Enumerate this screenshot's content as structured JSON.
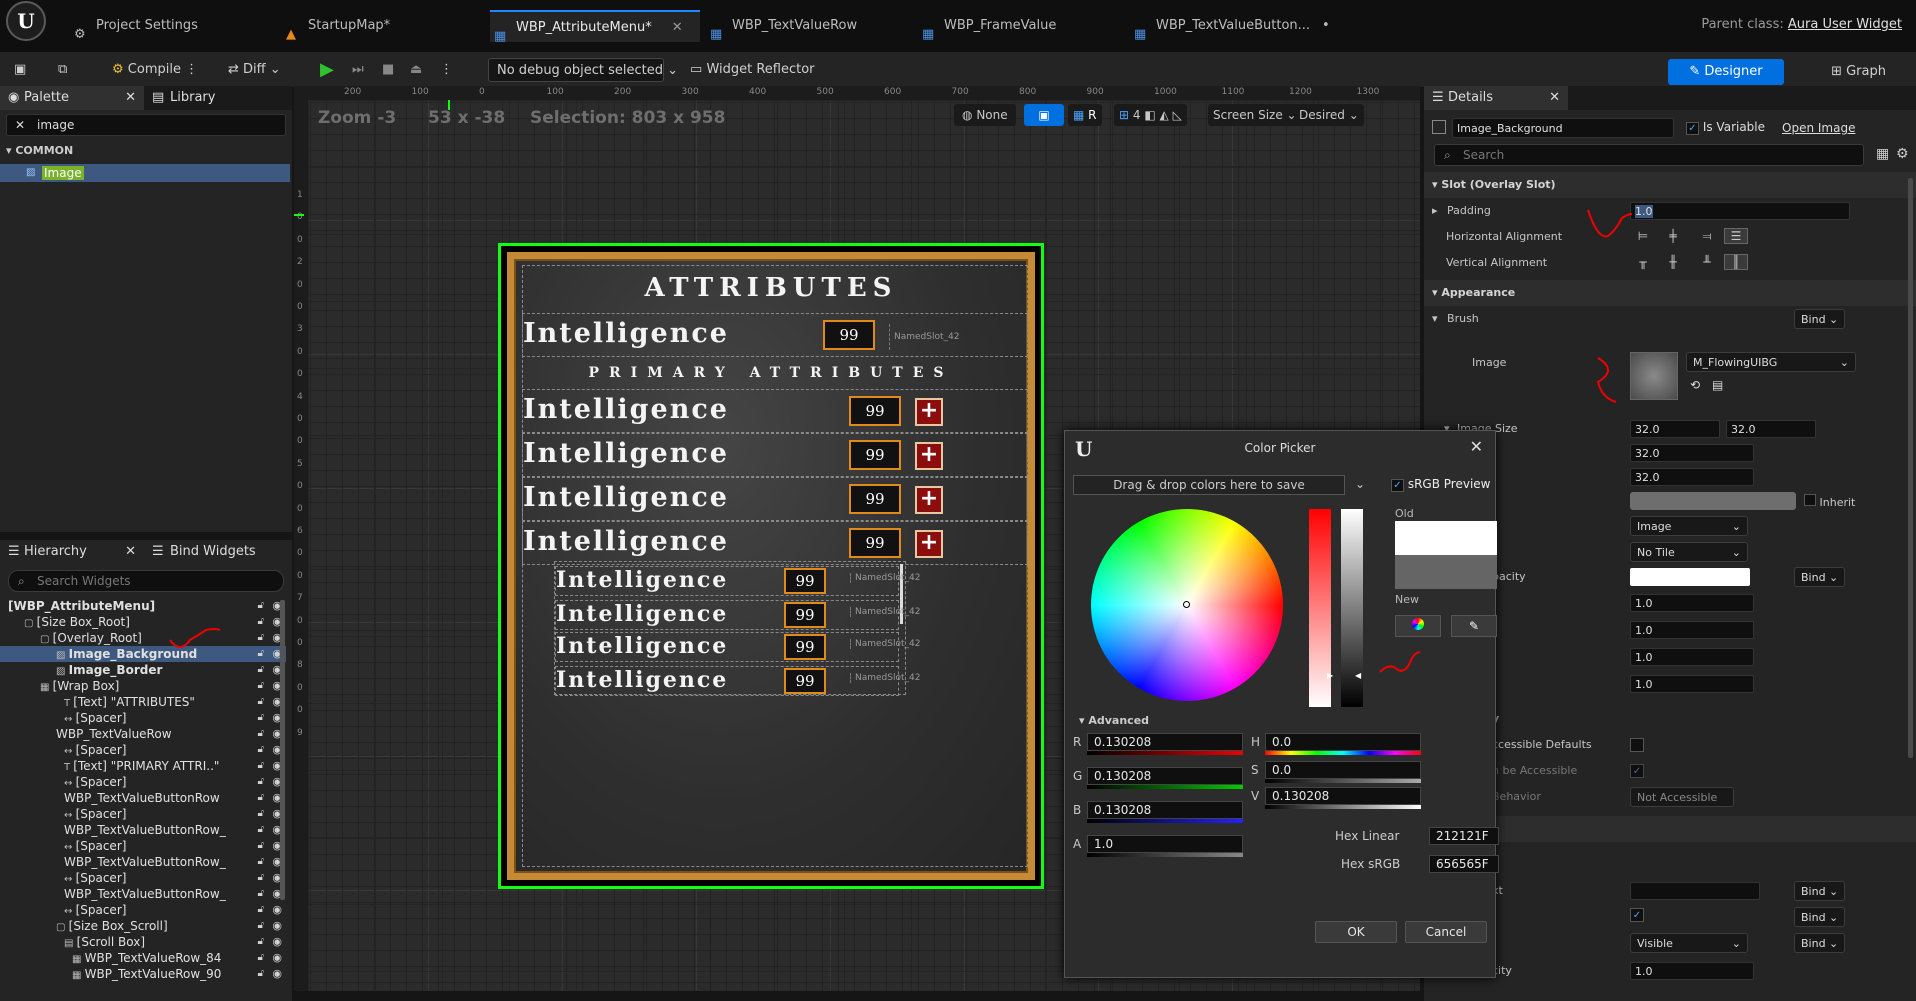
{
  "tabs": [
    {
      "label": "Project Settings",
      "active": false
    },
    {
      "label": "StartupMap*",
      "active": false
    },
    {
      "label": "WBP_AttributeMenu*",
      "active": true
    },
    {
      "label": "WBP_TextValueRow",
      "active": false
    },
    {
      "label": "WBP_FrameValue",
      "active": false
    },
    {
      "label": "WBP_TextValueButton...",
      "active": false
    }
  ],
  "parent_class": {
    "label": "Parent class:",
    "value": "Aura User Widget"
  },
  "toolbar": {
    "compile": "Compile",
    "diff": "Diff",
    "debug": "No debug object selected",
    "reflector": "Widget Reflector",
    "designer": "Designer",
    "graph": "Graph"
  },
  "palette": {
    "tab": "Palette",
    "library_tab": "Library",
    "search_value": "image",
    "category": "COMMON",
    "item": "Image"
  },
  "hierarchy": {
    "tab": "Hierarchy",
    "bind_tab": "Bind Widgets",
    "search_placeholder": "Search Widgets",
    "rows": [
      "[WBP_AttributeMenu]",
      "[Size Box_Root]",
      "[Overlay_Root]",
      "Image_Background",
      "Image_Border",
      "[Wrap Box]",
      "[Text] \"ATTRIBUTES\"",
      "[Spacer]",
      "WBP_TextValueRow",
      "[Spacer]",
      "[Text] \"PRIMARY ATTRI..\"",
      "[Spacer]",
      "WBP_TextValueButtonRow",
      "[Spacer]",
      "WBP_TextValueButtonRow_",
      "[Spacer]",
      "WBP_TextValueButtonRow_",
      "[Spacer]",
      "WBP_TextValueButtonRow_",
      "[Spacer]",
      "[Size Box_Scroll]",
      "[Scroll Box]",
      "WBP_TextValueRow_84",
      "WBP_TextValueRow_90"
    ]
  },
  "canvas": {
    "zoom": "Zoom -3",
    "size": "53 x -38",
    "selection": "Selection: 803 x 958",
    "none": "None",
    "r": "R",
    "grid": "4",
    "screen_size": "Screen Size",
    "desired": "Desired",
    "hticks": [
      "200",
      "100",
      "0",
      "100",
      "200",
      "300",
      "400",
      "500",
      "600",
      "700",
      "800",
      "900",
      "1000",
      "1100",
      "1200",
      "1300"
    ],
    "vticks": [
      "1",
      "0",
      "0",
      "2",
      "0",
      "0",
      "3",
      "0",
      "0",
      "4",
      "0",
      "0",
      "5",
      "0",
      "0",
      "6",
      "0",
      "0",
      "7",
      "0",
      "0",
      "8",
      "0",
      "0",
      "9"
    ]
  },
  "widget": {
    "title": "ATTRIBUTES",
    "subtitle": "PRIMARY ATTRIBUTES",
    "row_name": "Intelligence",
    "value": "99",
    "named_slot": "NamedSlot_42",
    "plus": "+"
  },
  "details": {
    "tab": "Details",
    "name": "Image_Background",
    "is_variable": "Is Variable",
    "open_image": "Open Image",
    "search": "Search",
    "slot_section": "Slot (Overlay Slot)",
    "padding": "Padding",
    "padding_value": "1.0",
    "h_align": "Horizontal Alignment",
    "v_align": "Vertical Alignment",
    "appearance": "Appearance",
    "brush": "Brush",
    "bind": "Bind",
    "image": "Image",
    "image_asset": "M_FlowingUIBG",
    "image_size": "Image Size",
    "size_x": "32.0",
    "size_y": "32.0",
    "v1": "32.0",
    "v2": "32.0",
    "inherit": "Inherit",
    "draw_as": "Image",
    "tiling": "No Tile",
    "opacity_lbl": "pacity",
    "one": "1.0",
    "frag_y": "y",
    "accessible": "ccessible Defaults",
    "can_accessible": "n be Accessible",
    "behavior": "Behavior",
    "not_accessible": "Not Accessible",
    "xt": "xt",
    "visible": "Visible",
    "city": "city"
  },
  "picker": {
    "title": "Color Picker",
    "drag": "Drag & drop colors here to save",
    "srgb": "sRGB Preview",
    "old": "Old",
    "new": "New",
    "advanced": "Advanced",
    "r": "R",
    "g": "G",
    "b": "B",
    "a": "A",
    "h": "H",
    "s": "S",
    "v": "V",
    "r_val": "0.130208",
    "g_val": "0.130208",
    "b_val": "0.130208",
    "a_val": "1.0",
    "h_val": "0.0",
    "s_val": "0.0",
    "v_val": "0.130208",
    "hex_linear_lbl": "Hex Linear",
    "hex_linear": "212121F",
    "hex_srgb_lbl": "Hex sRGB",
    "hex_srgb": "656565F",
    "ok": "OK",
    "cancel": "Cancel"
  },
  "colors": {
    "accent": "#0070e0",
    "selection": "#3e5980",
    "frame": "#c58a35",
    "value_border": "#e08a1a",
    "plus_bg": "#8c0d0d"
  }
}
